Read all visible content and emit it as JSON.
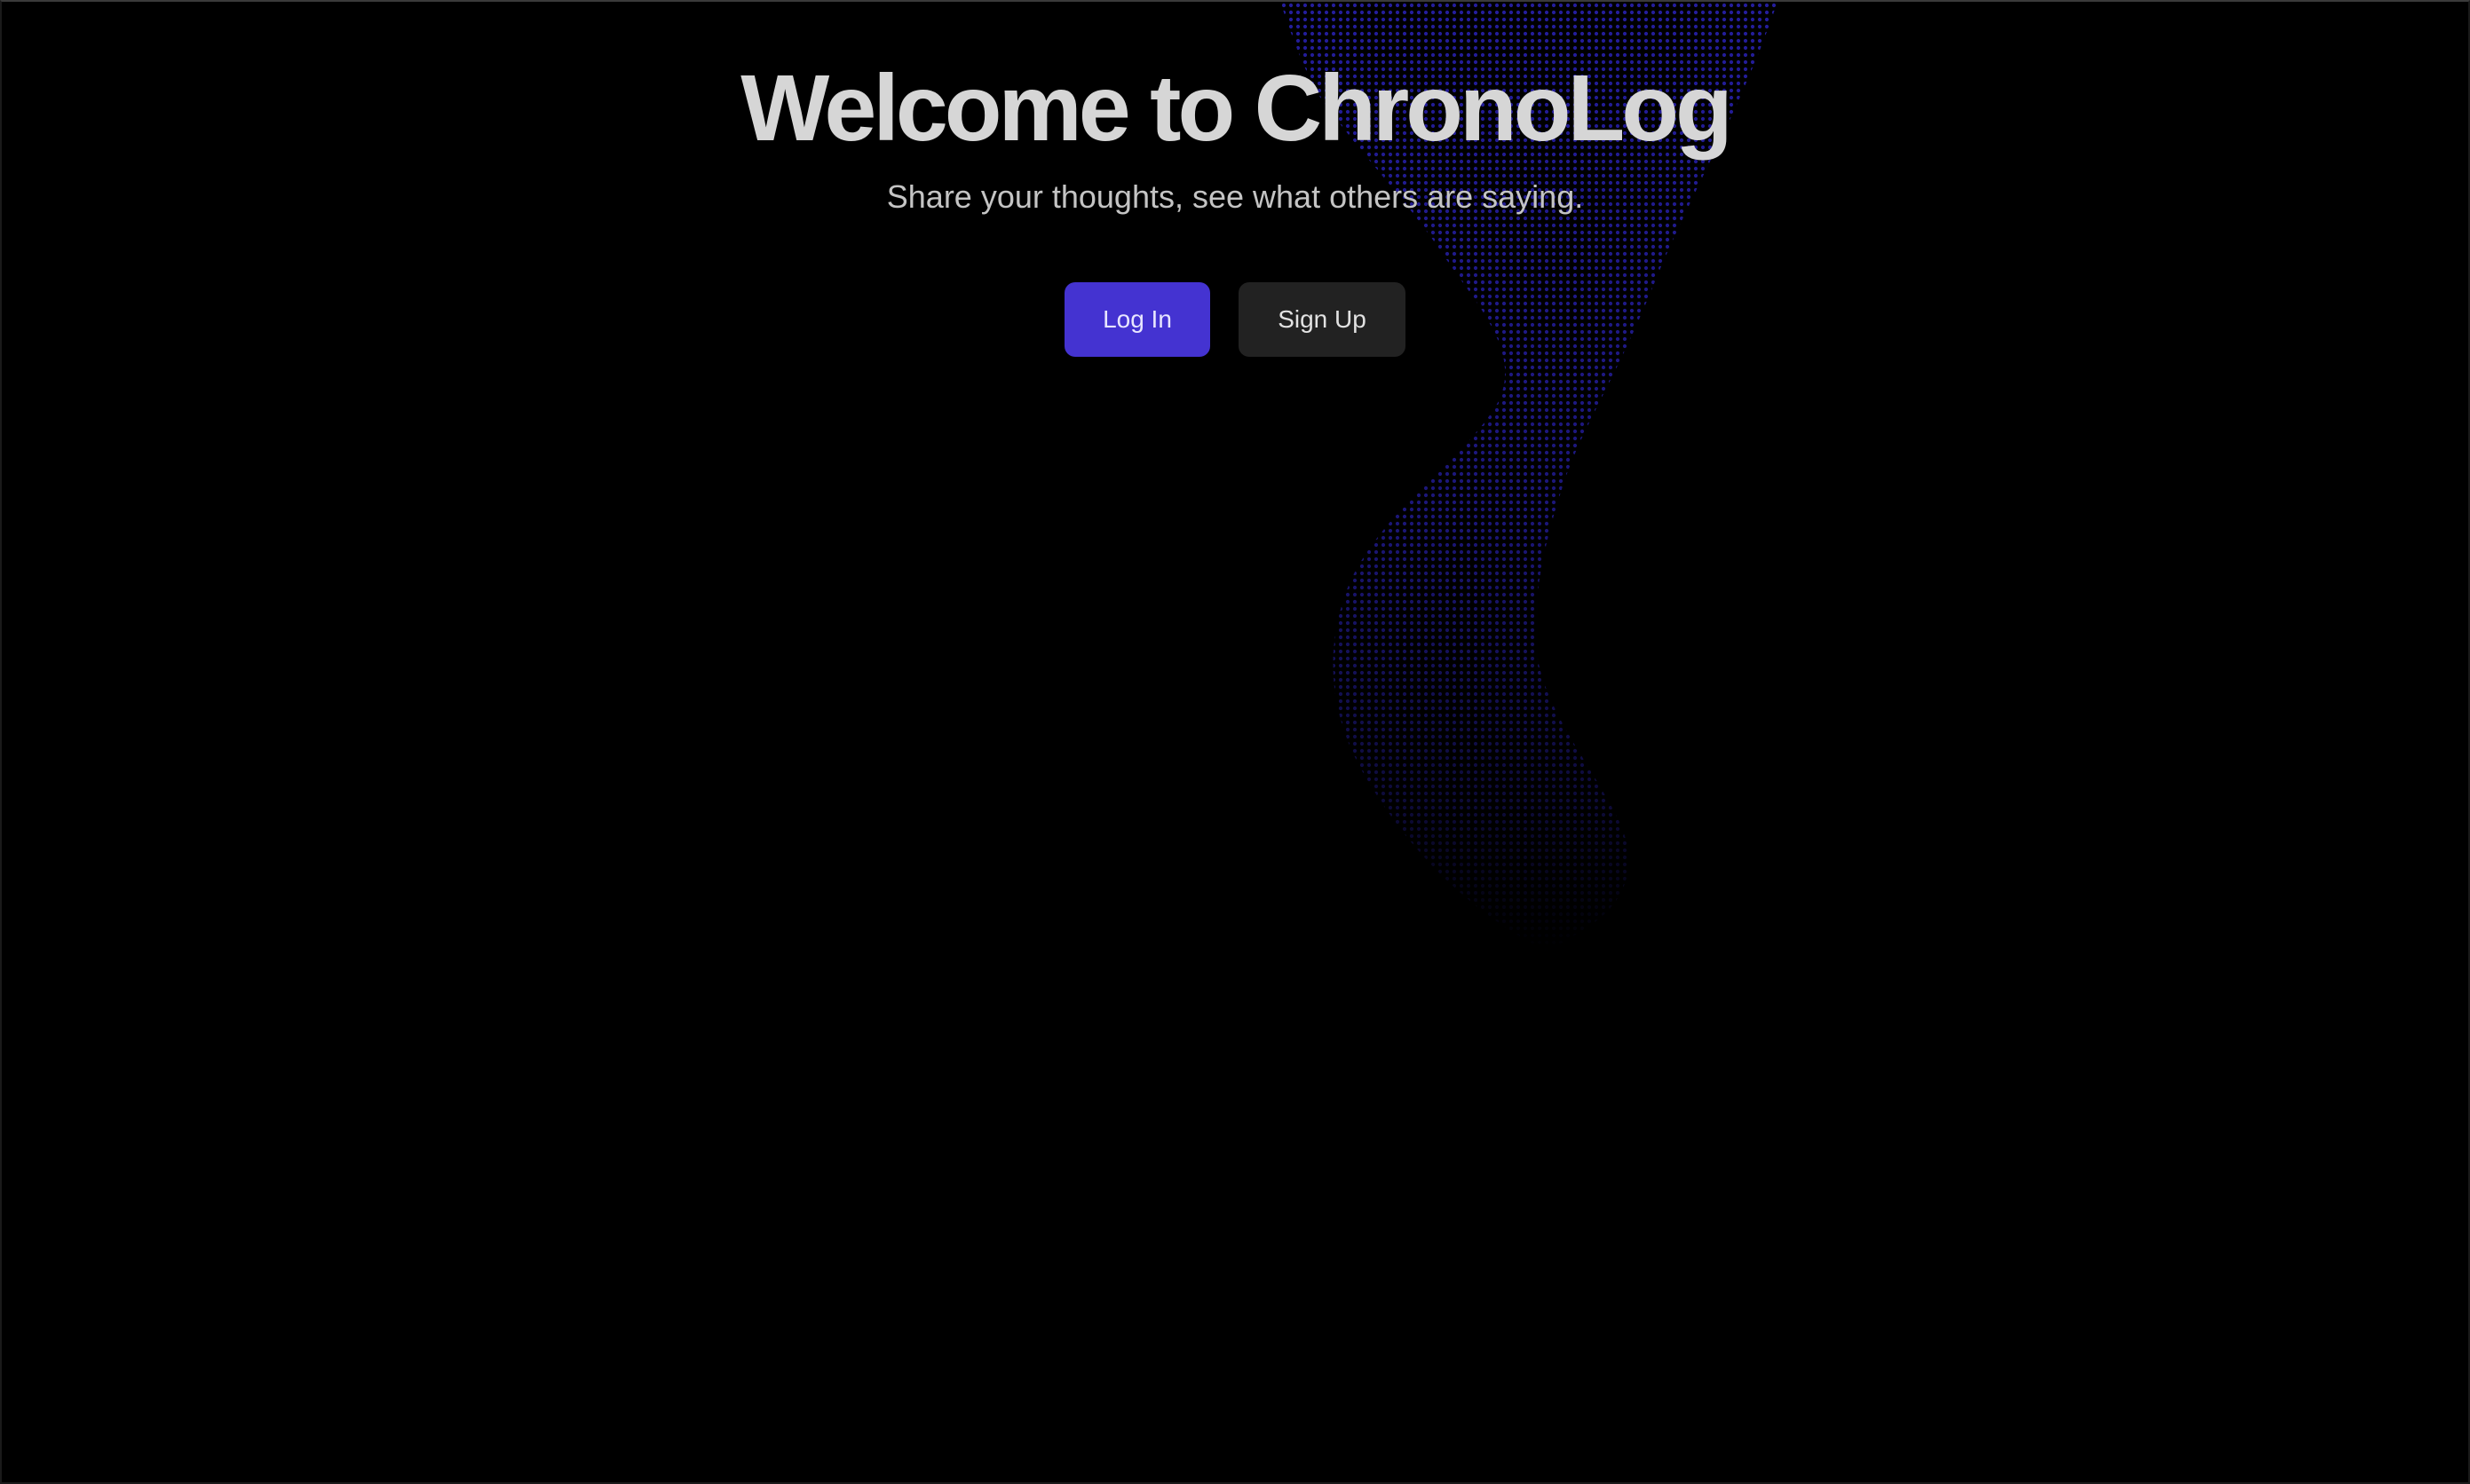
{
  "hero": {
    "title": "Welcome to ChronoLog",
    "subtitle": "Share your thoughts, see what others are saying."
  },
  "actions": {
    "login_label": "Log In",
    "signup_label": "Sign Up"
  },
  "colors": {
    "background": "#000000",
    "primary_button": "#4433d1",
    "secondary_button": "#222222",
    "pattern_dots": "#2a22b8"
  }
}
